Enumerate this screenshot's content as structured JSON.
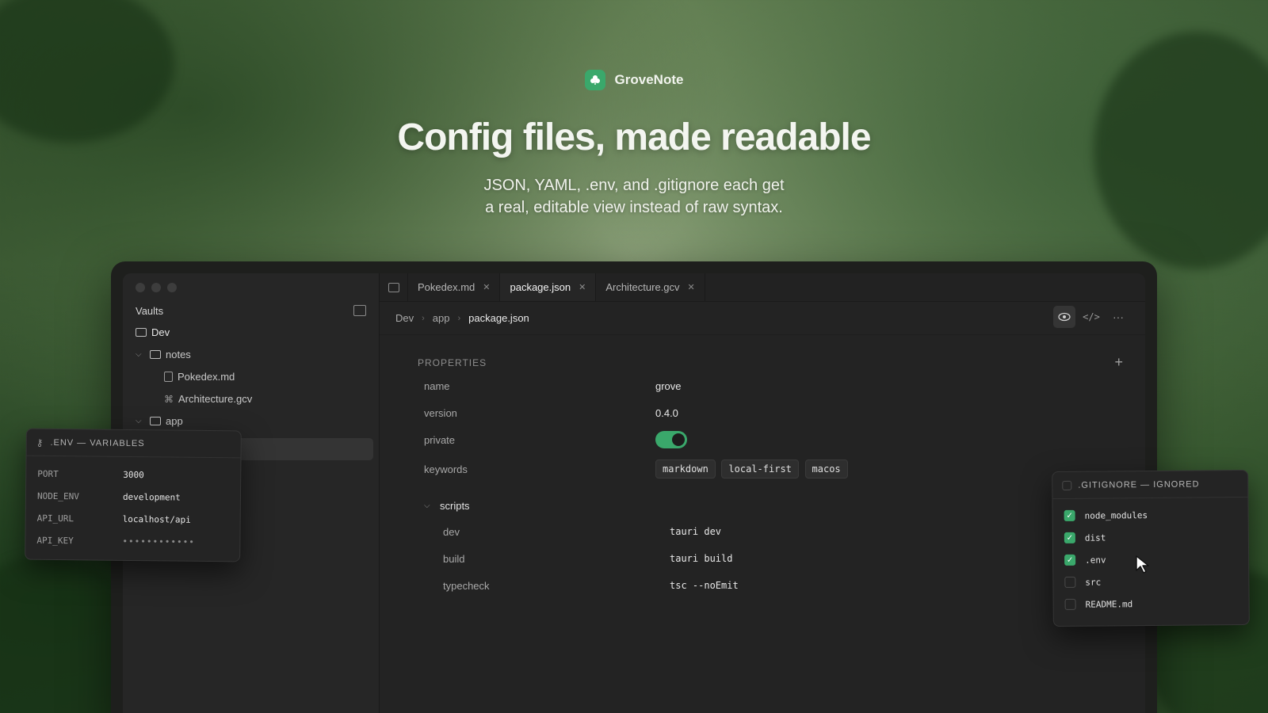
{
  "brand": {
    "name": "GroveNote"
  },
  "hero": {
    "headline": "Config files, made readable",
    "subline_1": "JSON, YAML, .env, and .gitignore each get",
    "subline_2": "a real, editable view instead of raw syntax."
  },
  "sidebar": {
    "vaults_label": "Vaults",
    "tree": [
      {
        "label": "Dev"
      },
      {
        "label": "notes"
      },
      {
        "label": "Pokedex.md"
      },
      {
        "label": "Architecture.gcv"
      },
      {
        "label": "app"
      }
    ]
  },
  "tabs": [
    {
      "label": "Pokedex.md"
    },
    {
      "label": "package.json"
    },
    {
      "label": "Architecture.gcv"
    }
  ],
  "breadcrumb": [
    "Dev",
    "app",
    "package.json"
  ],
  "properties": {
    "header": "PROPERTIES",
    "rows": [
      {
        "key": "name",
        "value": "grove"
      },
      {
        "key": "version",
        "value": "0.4.0"
      },
      {
        "key": "private",
        "value": true
      },
      {
        "key": "keywords",
        "chips": [
          "markdown",
          "local-first",
          "macos"
        ]
      }
    ],
    "scripts": {
      "label": "scripts",
      "rows": [
        {
          "key": "dev",
          "value": "tauri dev"
        },
        {
          "key": "build",
          "value": "tauri build"
        },
        {
          "key": "typecheck",
          "value": "tsc --noEmit"
        }
      ]
    }
  },
  "env_panel": {
    "title": ".ENV — VARIABLES",
    "rows": [
      {
        "key": "PORT",
        "value": "3000"
      },
      {
        "key": "NODE_ENV",
        "value": "development"
      },
      {
        "key": "API_URL",
        "value": "localhost/api"
      },
      {
        "key": "API_KEY",
        "value": "••••••••••••"
      }
    ]
  },
  "gitignore_panel": {
    "title": ".GITIGNORE — IGNORED",
    "rows": [
      {
        "label": "node_modules",
        "checked": true
      },
      {
        "label": "dist",
        "checked": true
      },
      {
        "label": ".env",
        "checked": true
      },
      {
        "label": "src",
        "checked": false
      },
      {
        "label": "README.md",
        "checked": false
      }
    ]
  },
  "colors": {
    "accent": "#3aa86b",
    "window_bg": "#232323"
  }
}
